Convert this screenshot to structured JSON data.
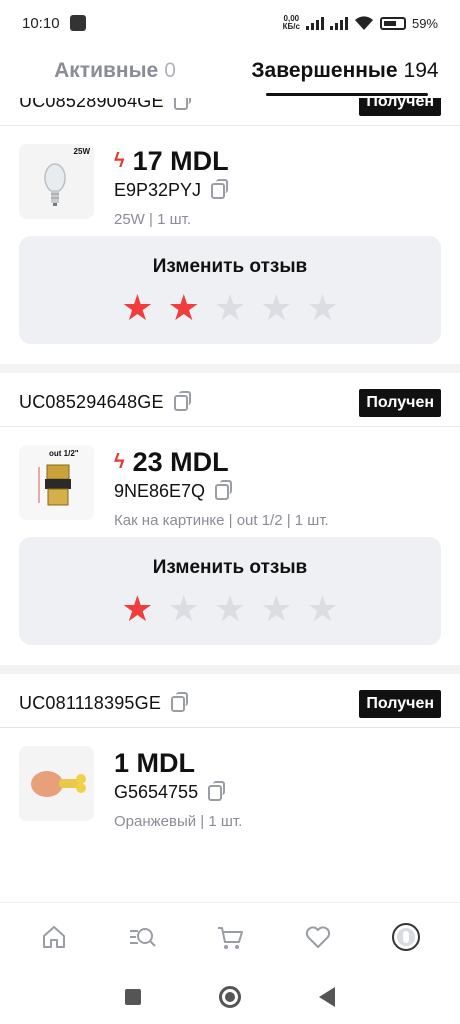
{
  "status_bar": {
    "time": "10:10",
    "net_speed_top": "0,00",
    "net_speed_bottom": "КБ/с",
    "battery": "59%"
  },
  "tabs": [
    {
      "label": "Активные",
      "count": "0",
      "active": false
    },
    {
      "label": "Завершенные",
      "count": "194",
      "active": true
    }
  ],
  "orders": [
    {
      "id": "UC085289064GE",
      "status": "Получен",
      "price": "17 MDL",
      "sku": "E9P32PYJ",
      "variant": "25W | 1 шт.",
      "thumb_label": "25W",
      "review_title": "Изменить отзыв",
      "rating": 2
    },
    {
      "id": "UC085294648GE",
      "status": "Получен",
      "price": "23 MDL",
      "sku": "9NE86E7Q",
      "variant": "Как на картинке | out 1/2 | 1 шт.",
      "thumb_label": "out 1/2\"",
      "review_title": "Изменить отзыв",
      "rating": 1
    },
    {
      "id": "UC081118395GE",
      "status": "Получен",
      "price": "1 MDL",
      "sku": "G5654755",
      "variant": "Оранжевый | 1 шт."
    }
  ],
  "colors": {
    "accent_red": "#f03e3e",
    "badge_bg": "#111111",
    "review_bg": "#eff0f4"
  },
  "bottom_nav": [
    "home-icon",
    "catalog-search-icon",
    "cart-icon",
    "heart-icon",
    "profile-icon"
  ]
}
